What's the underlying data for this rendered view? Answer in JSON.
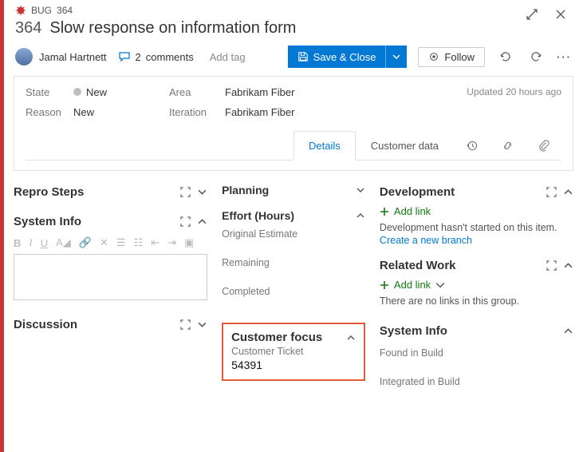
{
  "breadcrumb": {
    "type": "BUG",
    "id": "364"
  },
  "title": {
    "id": "364",
    "text": "Slow response on information form"
  },
  "assigned_to": "Jamal Hartnett",
  "comments": {
    "count": "2",
    "label": "comments"
  },
  "add_tag": "Add tag",
  "actions": {
    "save": "Save & Close",
    "follow": "Follow"
  },
  "meta": {
    "state_label": "State",
    "state_value": "New",
    "reason_label": "Reason",
    "reason_value": "New",
    "area_label": "Area",
    "area_value": "Fabrikam Fiber",
    "iteration_label": "Iteration",
    "iteration_value": "Fabrikam Fiber",
    "updated": "Updated 20 hours ago"
  },
  "tabs": {
    "details": "Details",
    "customer_data": "Customer data"
  },
  "left": {
    "repro": "Repro Steps",
    "sysinfo": "System Info",
    "discussion": "Discussion"
  },
  "mid": {
    "planning": "Planning",
    "effort": "Effort (Hours)",
    "original": "Original Estimate",
    "remaining": "Remaining",
    "completed": "Completed",
    "customer_focus": "Customer focus",
    "ticket_label": "Customer Ticket",
    "ticket_value": "54391"
  },
  "right": {
    "development": "Development",
    "add_link": "Add link",
    "dev_hint": "Development hasn't started on this item.",
    "create_branch": "Create a new branch",
    "related": "Related Work",
    "related_hint": "There are no links in this group.",
    "sysinfo": "System Info",
    "found": "Found in Build",
    "integrated": "Integrated in Build"
  }
}
